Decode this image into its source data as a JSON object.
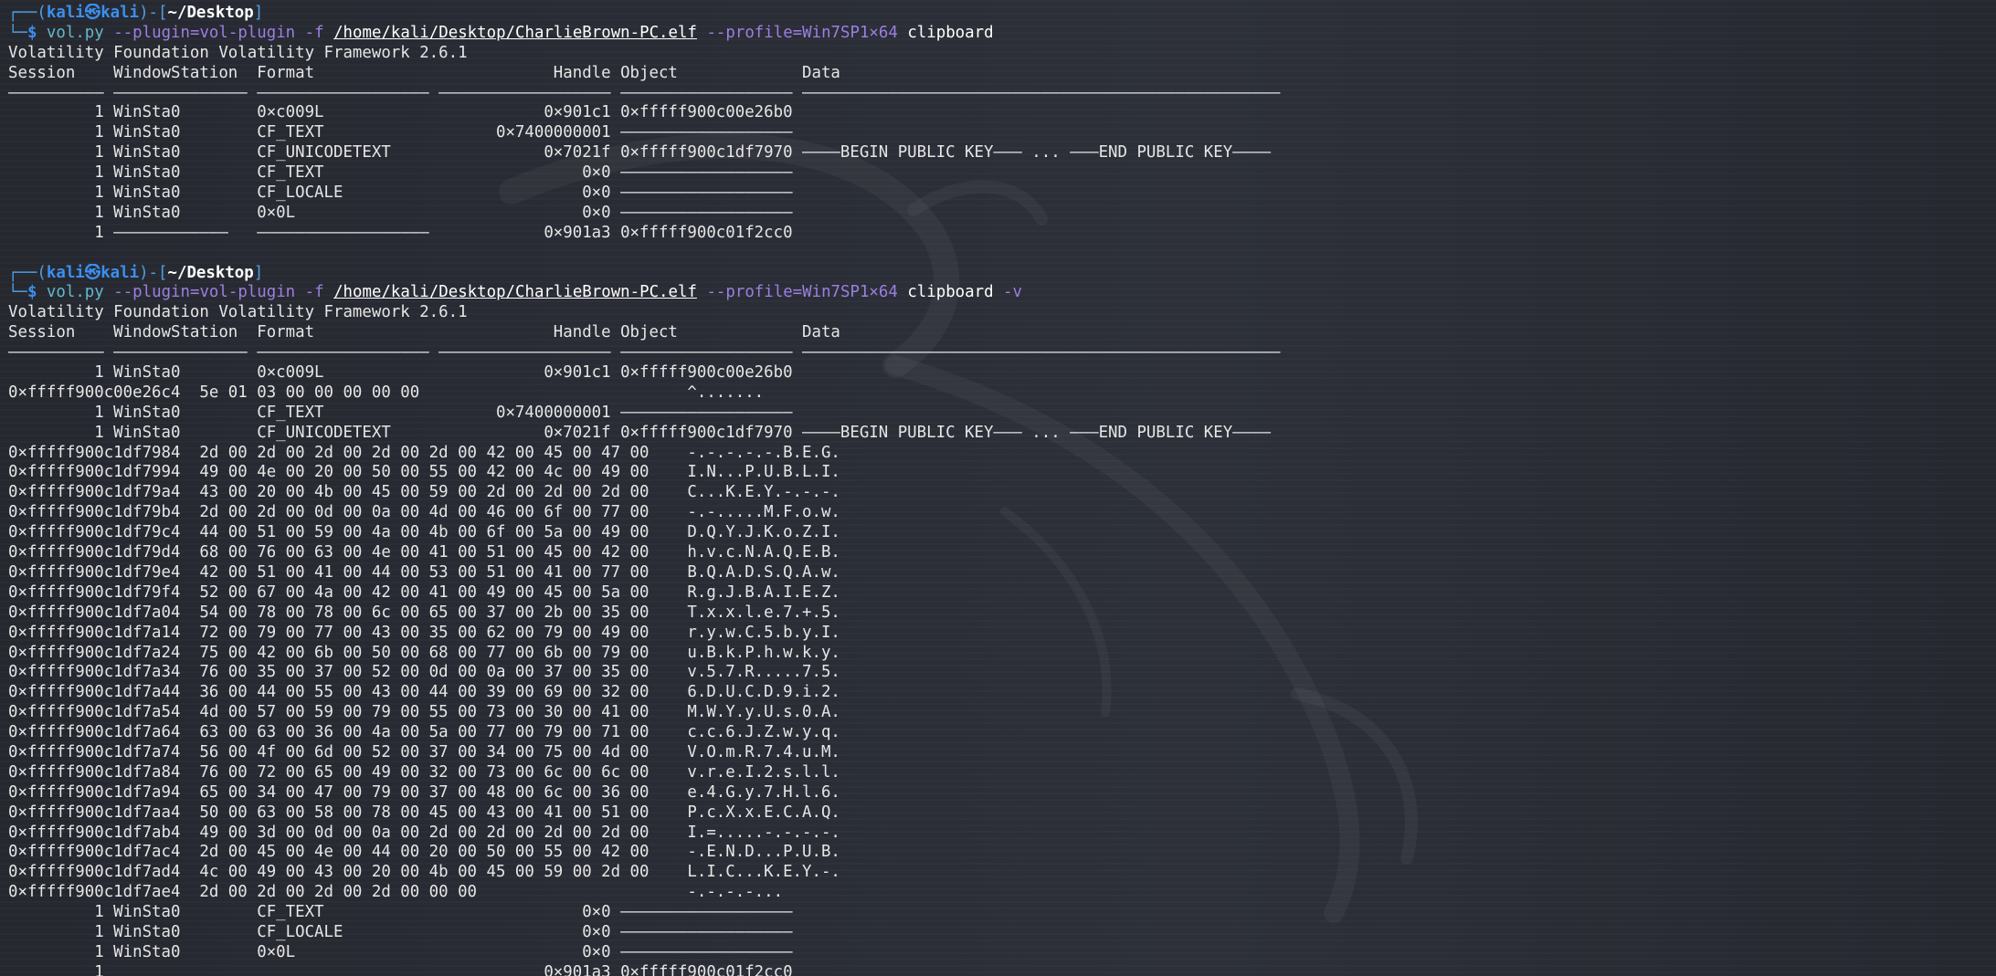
{
  "prompt": {
    "user": "kali",
    "at": "㉿",
    "host": "kali",
    "cwd": "~/Desktop"
  },
  "commands": [
    {
      "program": "vol.py",
      "plugin_opt": "--plugin=vol-plugin",
      "file_opt": "-f",
      "file": "/home/kali/Desktop/CharlieBrown-PC.elf",
      "profile_opt": "--profile=Win7SP1×64",
      "plugin": "clipboard",
      "extra": ""
    },
    {
      "program": "vol.py",
      "plugin_opt": "--plugin=vol-plugin",
      "file_opt": "-f",
      "file": "/home/kali/Desktop/CharlieBrown-PC.elf",
      "profile_opt": "--profile=Win7SP1×64",
      "plugin": "clipboard",
      "extra": " -v"
    }
  ],
  "framework_banner": "Volatility Foundation Volatility Framework 2.6.1",
  "columns": [
    "Session",
    "WindowStation",
    "Format",
    "Handle",
    "Object",
    "Data"
  ],
  "run1_rows": [
    [
      "1",
      "WinSta0",
      "0×c009L",
      "0×901c1",
      "0×fffff900c00e26b0",
      ""
    ],
    [
      "1",
      "WinSta0",
      "CF_TEXT",
      "0×7400000001",
      "——————————————————",
      ""
    ],
    [
      "1",
      "WinSta0",
      "CF_UNICODETEXT",
      "0×7021f",
      "0×fffff900c1df7970",
      "————BEGIN PUBLIC KEY——— ... ———END PUBLIC KEY————"
    ],
    [
      "1",
      "WinSta0",
      "CF_TEXT",
      "0×0",
      "——————————————————",
      ""
    ],
    [
      "1",
      "WinSta0",
      "CF_LOCALE",
      "0×0",
      "——————————————————",
      ""
    ],
    [
      "1",
      "WinSta0",
      "0×0L",
      "0×0",
      "——————————————————",
      ""
    ],
    [
      "1",
      "————————————",
      "——————————————————",
      "0×901a3",
      "0×fffff900c01f2cc0",
      ""
    ]
  ],
  "run2_rows_a": [
    [
      "1",
      "WinSta0",
      "0×c009L",
      "0×901c1",
      "0×fffff900c00e26b0",
      ""
    ]
  ],
  "run2_dump_a": [
    [
      "0×fffff900c00e26c4",
      "5e 01 03 00 00 00 00 00",
      "^......."
    ]
  ],
  "run2_rows_b": [
    [
      "1",
      "WinSta0",
      "CF_TEXT",
      "0×7400000001",
      "——————————————————",
      ""
    ],
    [
      "1",
      "WinSta0",
      "CF_UNICODETEXT",
      "0×7021f",
      "0×fffff900c1df7970",
      "————BEGIN PUBLIC KEY——— ... ———END PUBLIC KEY————"
    ]
  ],
  "run2_dump_b": [
    [
      "0×fffff900c1df7984",
      "2d 00 2d 00 2d 00 2d 00 2d 00 42 00 45 00 47 00",
      "-.-.-.-.-.B.E.G."
    ],
    [
      "0×fffff900c1df7994",
      "49 00 4e 00 20 00 50 00 55 00 42 00 4c 00 49 00",
      "I.N...P.U.B.L.I."
    ],
    [
      "0×fffff900c1df79a4",
      "43 00 20 00 4b 00 45 00 59 00 2d 00 2d 00 2d 00",
      "C...K.E.Y.-.-.-."
    ],
    [
      "0×fffff900c1df79b4",
      "2d 00 2d 00 0d 00 0a 00 4d 00 46 00 6f 00 77 00",
      "-.-.....M.F.o.w."
    ],
    [
      "0×fffff900c1df79c4",
      "44 00 51 00 59 00 4a 00 4b 00 6f 00 5a 00 49 00",
      "D.Q.Y.J.K.o.Z.I."
    ],
    [
      "0×fffff900c1df79d4",
      "68 00 76 00 63 00 4e 00 41 00 51 00 45 00 42 00",
      "h.v.c.N.A.Q.E.B."
    ],
    [
      "0×fffff900c1df79e4",
      "42 00 51 00 41 00 44 00 53 00 51 00 41 00 77 00",
      "B.Q.A.D.S.Q.A.w."
    ],
    [
      "0×fffff900c1df79f4",
      "52 00 67 00 4a 00 42 00 41 00 49 00 45 00 5a 00",
      "R.g.J.B.A.I.E.Z."
    ],
    [
      "0×fffff900c1df7a04",
      "54 00 78 00 78 00 6c 00 65 00 37 00 2b 00 35 00",
      "T.x.x.l.e.7.+.5."
    ],
    [
      "0×fffff900c1df7a14",
      "72 00 79 00 77 00 43 00 35 00 62 00 79 00 49 00",
      "r.y.w.C.5.b.y.I."
    ],
    [
      "0×fffff900c1df7a24",
      "75 00 42 00 6b 00 50 00 68 00 77 00 6b 00 79 00",
      "u.B.k.P.h.w.k.y."
    ],
    [
      "0×fffff900c1df7a34",
      "76 00 35 00 37 00 52 00 0d 00 0a 00 37 00 35 00",
      "v.5.7.R.....7.5."
    ],
    [
      "0×fffff900c1df7a44",
      "36 00 44 00 55 00 43 00 44 00 39 00 69 00 32 00",
      "6.D.U.C.D.9.i.2."
    ],
    [
      "0×fffff900c1df7a54",
      "4d 00 57 00 59 00 79 00 55 00 73 00 30 00 41 00",
      "M.W.Y.y.U.s.0.A."
    ],
    [
      "0×fffff900c1df7a64",
      "63 00 63 00 36 00 4a 00 5a 00 77 00 79 00 71 00",
      "c.c.6.J.Z.w.y.q."
    ],
    [
      "0×fffff900c1df7a74",
      "56 00 4f 00 6d 00 52 00 37 00 34 00 75 00 4d 00",
      "V.O.m.R.7.4.u.M."
    ],
    [
      "0×fffff900c1df7a84",
      "76 00 72 00 65 00 49 00 32 00 73 00 6c 00 6c 00",
      "v.r.e.I.2.s.l.l."
    ],
    [
      "0×fffff900c1df7a94",
      "65 00 34 00 47 00 79 00 37 00 48 00 6c 00 36 00",
      "e.4.G.y.7.H.l.6."
    ],
    [
      "0×fffff900c1df7aa4",
      "50 00 63 00 58 00 78 00 45 00 43 00 41 00 51 00",
      "P.c.X.x.E.C.A.Q."
    ],
    [
      "0×fffff900c1df7ab4",
      "49 00 3d 00 0d 00 0a 00 2d 00 2d 00 2d 00 2d 00",
      "I.=.....-.-.-.-."
    ],
    [
      "0×fffff900c1df7ac4",
      "2d 00 45 00 4e 00 44 00 20 00 50 00 55 00 42 00",
      "-.E.N.D...P.U.B."
    ],
    [
      "0×fffff900c1df7ad4",
      "4c 00 49 00 43 00 20 00 4b 00 45 00 59 00 2d 00",
      "L.I.C...K.E.Y.-."
    ],
    [
      "0×fffff900c1df7ae4",
      "2d 00 2d 00 2d 00 2d 00 00 00",
      "-.-.-.-..."
    ]
  ],
  "run2_rows_c": [
    [
      "1",
      "WinSta0",
      "CF_TEXT",
      "0×0",
      "——————————————————",
      ""
    ],
    [
      "1",
      "WinSta0",
      "CF_LOCALE",
      "0×0",
      "——————————————————",
      ""
    ],
    [
      "1",
      "WinSta0",
      "0×0L",
      "0×0",
      "——————————————————",
      ""
    ],
    [
      "1",
      "",
      "",
      "0×901a3",
      "0×fffff900c01f2cc0",
      ""
    ]
  ],
  "colors": {
    "background": "#23252e",
    "prompt_frame": "#4f9fe0",
    "prompt_user": "#3b8fee",
    "command": "#63b8c9",
    "option": "#9c7fe0",
    "text": "#e6e6e6"
  }
}
